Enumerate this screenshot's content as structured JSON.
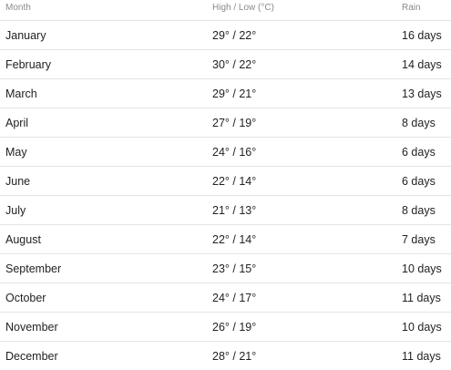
{
  "table": {
    "headers": {
      "month": "Month",
      "temp": "High / Low  (°C)",
      "rain": "Rain"
    },
    "rows": [
      {
        "month": "January",
        "temp": "29° / 22°",
        "rain": "16 days"
      },
      {
        "month": "February",
        "temp": "30° / 22°",
        "rain": "14 days"
      },
      {
        "month": "March",
        "temp": "29° / 21°",
        "rain": "13 days"
      },
      {
        "month": "April",
        "temp": "27° / 19°",
        "rain": "8 days"
      },
      {
        "month": "May",
        "temp": "24° / 16°",
        "rain": "6 days"
      },
      {
        "month": "June",
        "temp": "22° / 14°",
        "rain": "6 days"
      },
      {
        "month": "July",
        "temp": "21° / 13°",
        "rain": "8 days"
      },
      {
        "month": "August",
        "temp": "22° / 14°",
        "rain": "7 days"
      },
      {
        "month": "September",
        "temp": "23° / 15°",
        "rain": "10 days"
      },
      {
        "month": "October",
        "temp": "24° / 17°",
        "rain": "11 days"
      },
      {
        "month": "November",
        "temp": "26° / 19°",
        "rain": "10 days"
      },
      {
        "month": "December",
        "temp": "28° / 21°",
        "rain": "11 days"
      }
    ]
  }
}
